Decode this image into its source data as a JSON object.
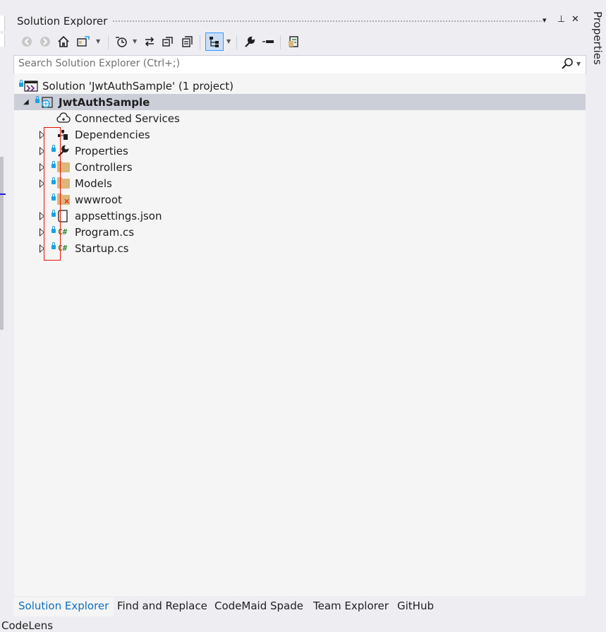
{
  "panel": {
    "title": "Solution Explorer",
    "window_controls": {
      "dropdown": "▾",
      "pin": "⊥",
      "close": "✕"
    }
  },
  "search": {
    "placeholder": "Search Solution Explorer (Ctrl+;)"
  },
  "tree": {
    "solution_label": "Solution 'JwtAuthSample' (1 project)",
    "project_label": "JwtAuthSample",
    "items": [
      {
        "label": "Connected Services",
        "icon": "cloud-icon",
        "expandable": false,
        "locked": false
      },
      {
        "label": "Dependencies",
        "icon": "dependencies-icon",
        "expandable": true,
        "locked": false
      },
      {
        "label": "Properties",
        "icon": "wrench-icon",
        "expandable": true,
        "locked": true
      },
      {
        "label": "Controllers",
        "icon": "folder-icon",
        "expandable": true,
        "locked": true
      },
      {
        "label": "Models",
        "icon": "folder-icon",
        "expandable": true,
        "locked": true
      },
      {
        "label": "wwwroot",
        "icon": "web-folder-icon",
        "expandable": false,
        "locked": true
      },
      {
        "label": "appsettings.json",
        "icon": "json-file-icon",
        "expandable": true,
        "locked": true
      },
      {
        "label": "Program.cs",
        "icon": "csharp-file-icon",
        "expandable": true,
        "locked": true
      },
      {
        "label": "Startup.cs",
        "icon": "csharp-file-icon",
        "expandable": true,
        "locked": true
      }
    ],
    "csharp_glyph": "C#"
  },
  "tabs": [
    {
      "label": "Solution Explorer",
      "active": true
    },
    {
      "label": "Find and Replace",
      "active": false
    },
    {
      "label": "CodeMaid Spade",
      "active": false
    },
    {
      "label": "Team Explorer",
      "active": false
    },
    {
      "label": "GitHub",
      "active": false
    }
  ],
  "status": {
    "codelens": "CodeLens"
  },
  "side_tab": {
    "label": "Properties"
  },
  "colors": {
    "accent": "#0e70c0",
    "highlight": "#ccced8",
    "lock": "#1ba1e2",
    "folder": "#dcb67a",
    "annotation": "#e51400"
  }
}
